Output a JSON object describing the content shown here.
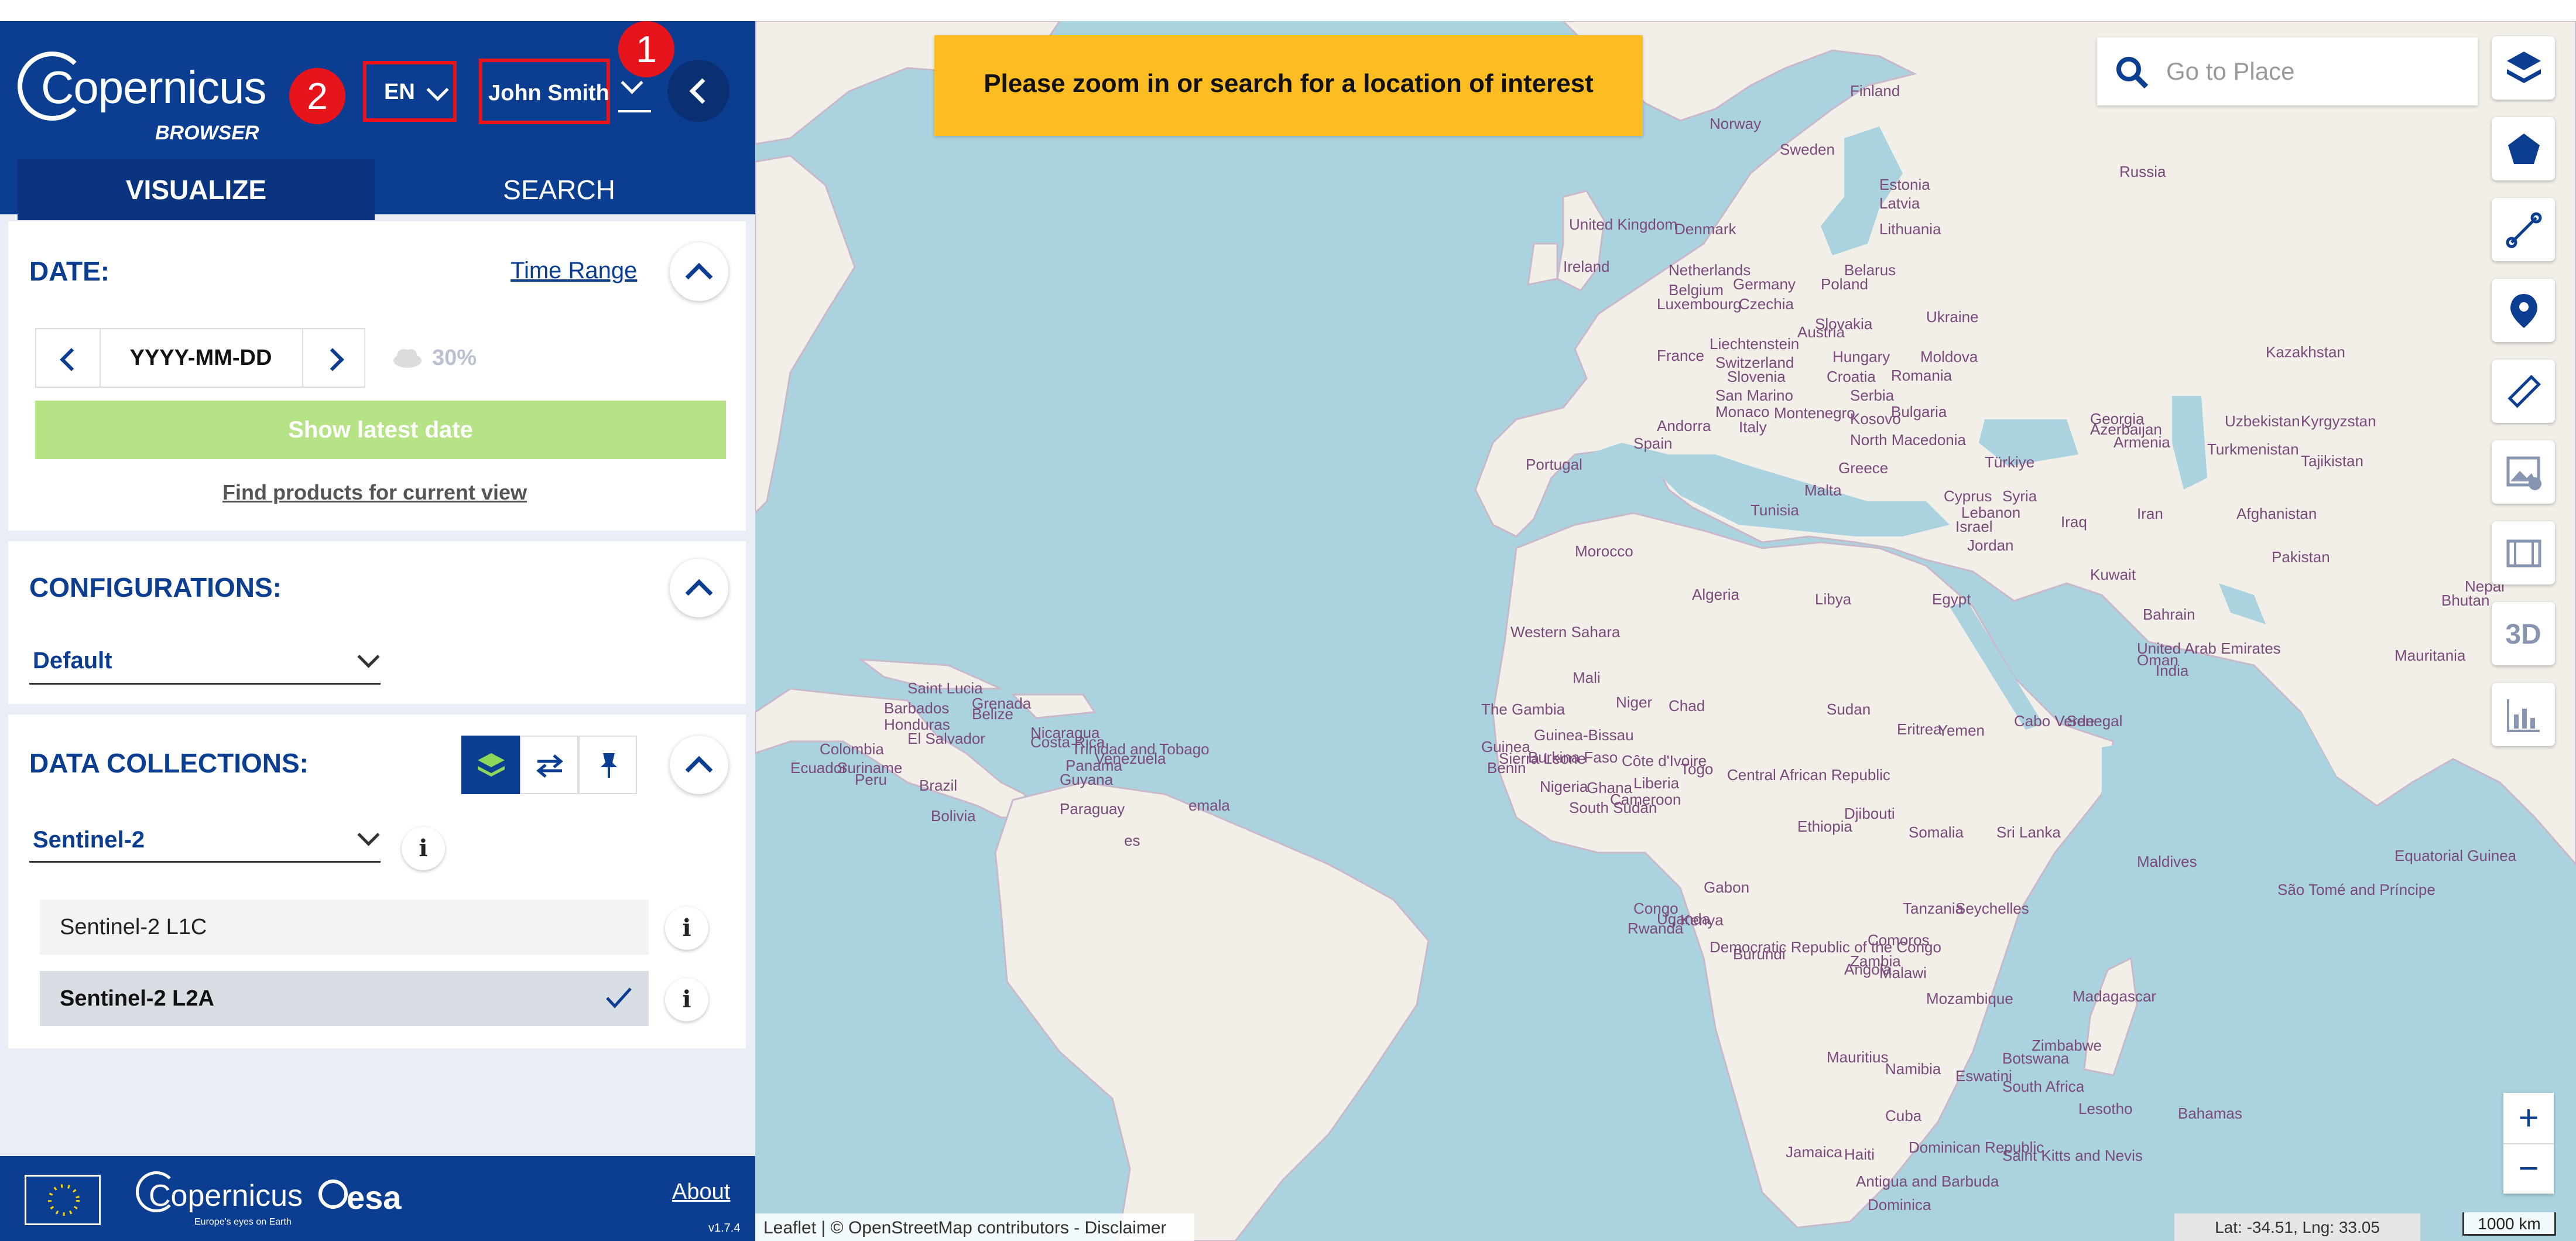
{
  "header": {
    "logo_word": "Copernicus",
    "logo_sub": "BROWSER",
    "language": "EN",
    "user": "John Smith",
    "annotation_1": "1",
    "annotation_2": "2"
  },
  "tabs": {
    "visualize": "VISUALIZE",
    "search": "SEARCH"
  },
  "date_section": {
    "title": "DATE:",
    "time_range_link": "Time Range",
    "date_placeholder": "YYYY-MM-DD",
    "cloud_cover": "30%",
    "show_latest": "Show latest date",
    "find_products": "Find products for current view"
  },
  "config_section": {
    "title": "CONFIGURATIONS:",
    "selected": "Default"
  },
  "collections_section": {
    "title": "DATA COLLECTIONS:",
    "selected": "Sentinel-2",
    "items": [
      {
        "label": "Sentinel-2 L1C",
        "selected": false
      },
      {
        "label": "Sentinel-2 L2A",
        "selected": true
      }
    ]
  },
  "footer": {
    "about": "About",
    "version": "v1.7.4",
    "copernicus": "Copernicus",
    "copernicus_tagline": "Europe's eyes on Earth",
    "esa": "esa"
  },
  "map": {
    "banner": "Please zoom in or search for a location of interest",
    "search_placeholder": "Go to Place",
    "tool_3d": "3D",
    "zoom_in": "+",
    "zoom_out": "−",
    "attribution": "Leaflet | © OpenStreetMap contributors - Disclaimer",
    "coords": "Lat: -34.51, Lng: 33.05",
    "scale": "1000 km",
    "labels": [
      "Finland",
      "Norway",
      "Sweden",
      "Russia",
      "Estonia",
      "Latvia",
      "Lithuania",
      "United Kingdom",
      "Denmark",
      "Ireland",
      "Netherlands",
      "Belgium",
      "Luxembourg",
      "Germany",
      "Poland",
      "Czechia",
      "Belarus",
      "Slovakia",
      "Austria",
      "Ukraine",
      "France",
      "Liechtenstein",
      "Switzerland",
      "Hungary",
      "Moldova",
      "Slovenia",
      "Croatia",
      "Romania",
      "San Marino",
      "Serbia",
      "Monaco",
      "Bulgaria",
      "Andorra",
      "Montenegro",
      "Kosovo",
      "Italy",
      "North Macedonia",
      "Spain",
      "Georgia",
      "Azerbaijan",
      "Armenia",
      "Kazakhstan",
      "Uzbekistan",
      "Kyrgyzstan",
      "Turkmenistan",
      "Tajikistan",
      "Portugal",
      "Greece",
      "Türkiye",
      "Malta",
      "Cyprus",
      "Syria",
      "Tunisia",
      "Lebanon",
      "Israel",
      "Iraq",
      "Iran",
      "Afghanistan",
      "Jordan",
      "Morocco",
      "Pakistan",
      "Kuwait",
      "Algeria",
      "Libya",
      "Egypt",
      "Bahrain",
      "Nepal",
      "Bhutan",
      "Western Sahara",
      "United Arab Emirates",
      "Oman",
      "India",
      "Mauritania",
      "Mali",
      "Niger",
      "Chad",
      "Sudan",
      "Eritrea",
      "Yemen",
      "Cabo Verde",
      "Senegal",
      "The Gambia",
      "Guinea-Bissau",
      "Guinea",
      "Sierra Leone",
      "Burkina Faso",
      "Benin",
      "Côte d'Ivoire",
      "Togo",
      "Nigeria",
      "Ghana",
      "Liberia",
      "Central African Republic",
      "Cameroon",
      "South Sudan",
      "Ethiopia",
      "Djibouti",
      "Somalia",
      "Sri Lanka",
      "Maldives",
      "Equatorial Guinea",
      "São Tomé and Príncipe",
      "Gabon",
      "Congo",
      "Uganda",
      "Kenya",
      "Rwanda",
      "Democratic Republic of the Congo",
      "Burundi",
      "Tanzania",
      "Seychelles",
      "Angola",
      "Comoros",
      "Zambia",
      "Malawi",
      "Mozambique",
      "Madagascar",
      "Mauritius",
      "Zimbabwe",
      "Namibia",
      "Botswana",
      "Eswatini",
      "South Africa",
      "Lesotho",
      "Bahamas",
      "Cuba",
      "Dominican Republic",
      "Jamaica",
      "Haiti",
      "Saint Kitts and Nevis",
      "Antigua and Barbuda",
      "Dominica",
      "Saint Lucia",
      "Barbados",
      "Grenada",
      "Belize",
      "Honduras",
      "El Salvador",
      "Nicaragua",
      "Trinidad and Tobago",
      "Costa Rica",
      "Panama",
      "Venezuela",
      "Guyana",
      "Colombia",
      "Suriname",
      "Ecuador",
      "Peru",
      "Brazil",
      "Bolivia",
      "Paraguay",
      "emala",
      "es"
    ]
  }
}
